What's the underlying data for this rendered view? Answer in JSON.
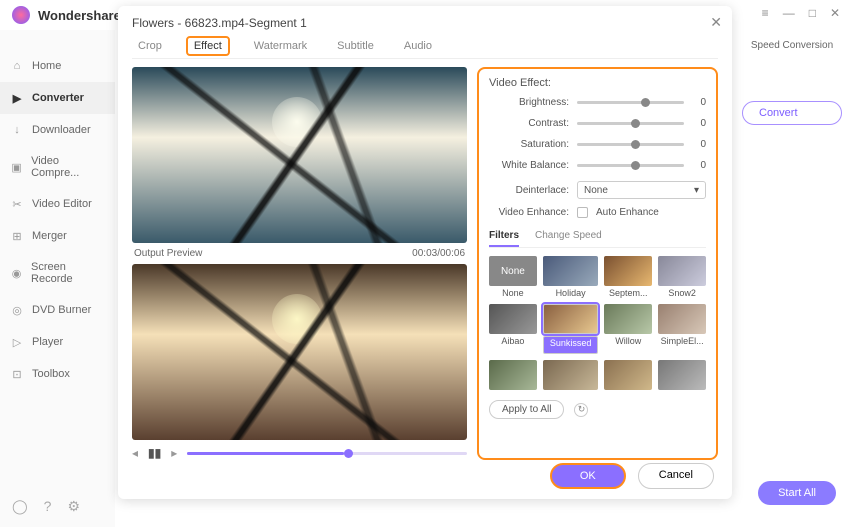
{
  "brand": "Wondershare",
  "win": {
    "menu": "≡",
    "min": "—",
    "max": "□",
    "close": "✕"
  },
  "sidebar": {
    "items": [
      {
        "label": "Home",
        "icon": "⌂"
      },
      {
        "label": "Converter",
        "icon": "▶"
      },
      {
        "label": "Downloader",
        "icon": "↓"
      },
      {
        "label": "Video Compre...",
        "icon": "▣"
      },
      {
        "label": "Video Editor",
        "icon": "✂"
      },
      {
        "label": "Merger",
        "icon": "⊞"
      },
      {
        "label": "Screen Recorde",
        "icon": "◉"
      },
      {
        "label": "DVD Burner",
        "icon": "◎"
      },
      {
        "label": "Player",
        "icon": "▷"
      },
      {
        "label": "Toolbox",
        "icon": "⊡"
      }
    ]
  },
  "modal": {
    "title": "Flowers - 66823.mp4-Segment 1",
    "tabs": [
      "Crop",
      "Effect",
      "Watermark",
      "Subtitle",
      "Audio"
    ],
    "output_label": "Output Preview",
    "timecode": "00:03/00:06",
    "ve_title": "Video Effect:",
    "sliders": [
      {
        "label": "Brightness:",
        "pos": 60,
        "val": "0"
      },
      {
        "label": "Contrast:",
        "pos": 50,
        "val": "0"
      },
      {
        "label": "Saturation:",
        "pos": 50,
        "val": "0"
      },
      {
        "label": "White Balance:",
        "pos": 50,
        "val": "0"
      }
    ],
    "deinterlace_label": "Deinterlace:",
    "deinterlace_value": "None",
    "enhance_label": "Video Enhance:",
    "enhance_option": "Auto Enhance",
    "sub_tabs": [
      "Filters",
      "Change Speed"
    ],
    "filters": [
      {
        "name": "None"
      },
      {
        "name": "Holiday"
      },
      {
        "name": "Septem..."
      },
      {
        "name": "Snow2"
      },
      {
        "name": "Aibao"
      },
      {
        "name": "Sunkissed"
      },
      {
        "name": "Willow"
      },
      {
        "name": "SimpleEl..."
      },
      {
        "name": ""
      },
      {
        "name": ""
      },
      {
        "name": ""
      },
      {
        "name": ""
      }
    ],
    "apply": "Apply to All",
    "ok": "OK",
    "cancel": "Cancel"
  },
  "right": {
    "speed": "Speed Conversion",
    "convert": "Convert",
    "startall": "Start All"
  }
}
